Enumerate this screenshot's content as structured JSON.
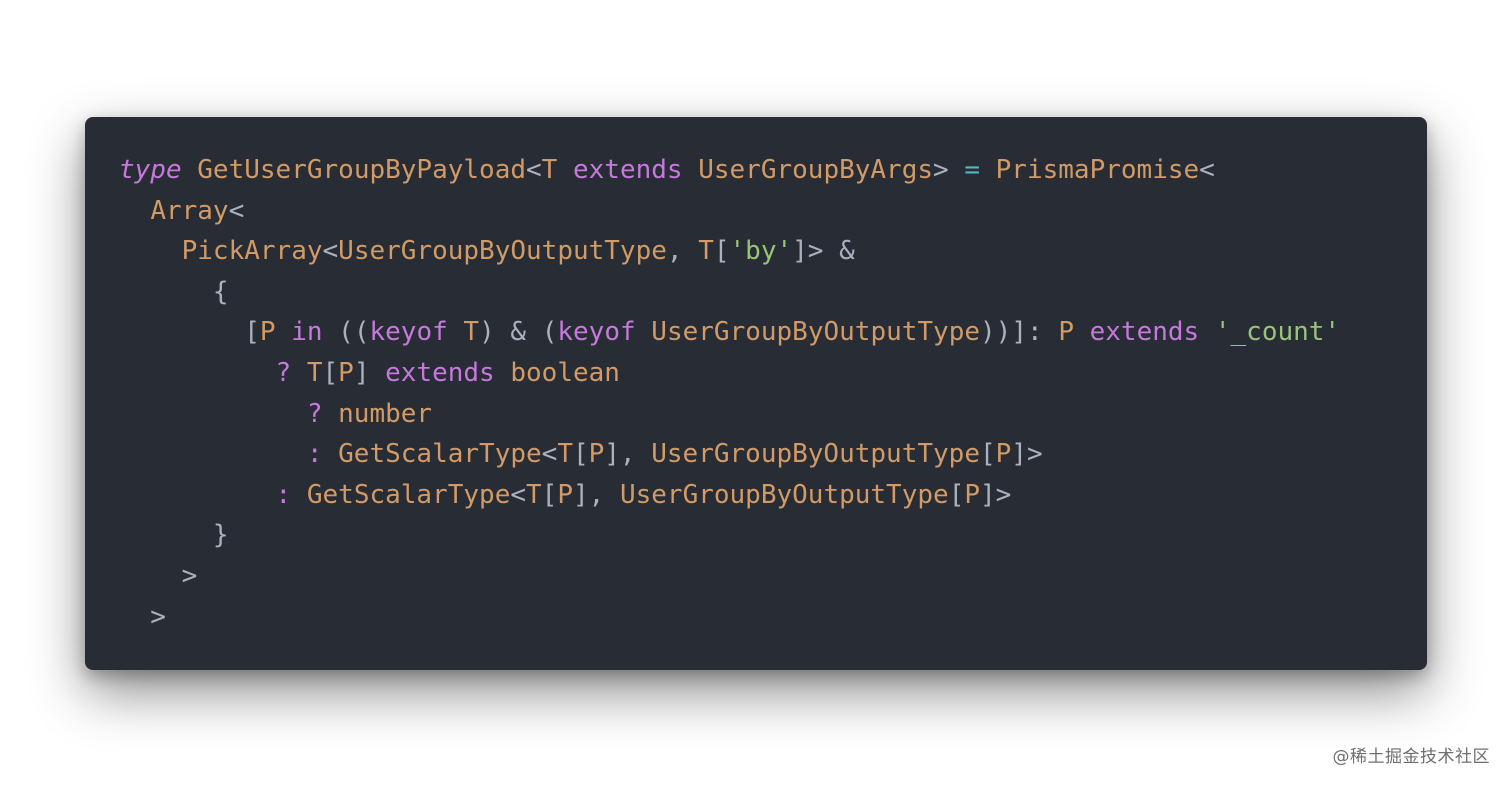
{
  "editor": {
    "theme_colors": {
      "background": "#282c34",
      "keyword": "#c678dd",
      "type": "#d19a66",
      "punctuation": "#abb2bf",
      "operator": "#56b6c2",
      "string": "#98c379"
    },
    "lines": [
      [
        {
          "t": "type",
          "k": "kwi"
        },
        {
          "t": " ",
          "k": "punc"
        },
        {
          "t": "GetUserGroupByPayload",
          "k": "type"
        },
        {
          "t": "<",
          "k": "punc"
        },
        {
          "t": "T",
          "k": "type"
        },
        {
          "t": " ",
          "k": "punc"
        },
        {
          "t": "extends",
          "k": "kw"
        },
        {
          "t": " ",
          "k": "punc"
        },
        {
          "t": "UserGroupByArgs",
          "k": "type"
        },
        {
          "t": "> ",
          "k": "punc"
        },
        {
          "t": "=",
          "k": "op"
        },
        {
          "t": " ",
          "k": "punc"
        },
        {
          "t": "PrismaPromise",
          "k": "type"
        },
        {
          "t": "<",
          "k": "punc"
        }
      ],
      [
        {
          "t": "  ",
          "k": "punc"
        },
        {
          "t": "Array",
          "k": "type"
        },
        {
          "t": "<",
          "k": "punc"
        }
      ],
      [
        {
          "t": "    ",
          "k": "punc"
        },
        {
          "t": "PickArray",
          "k": "type"
        },
        {
          "t": "<",
          "k": "punc"
        },
        {
          "t": "UserGroupByOutputType",
          "k": "type"
        },
        {
          "t": ", ",
          "k": "punc"
        },
        {
          "t": "T",
          "k": "type"
        },
        {
          "t": "[",
          "k": "punc"
        },
        {
          "t": "'by'",
          "k": "str"
        },
        {
          "t": "]> &",
          "k": "punc"
        }
      ],
      [
        {
          "t": "      {",
          "k": "punc"
        }
      ],
      [
        {
          "t": "        [",
          "k": "punc"
        },
        {
          "t": "P",
          "k": "type"
        },
        {
          "t": " ",
          "k": "punc"
        },
        {
          "t": "in",
          "k": "kw"
        },
        {
          "t": " ((",
          "k": "punc"
        },
        {
          "t": "keyof",
          "k": "kw"
        },
        {
          "t": " ",
          "k": "punc"
        },
        {
          "t": "T",
          "k": "type"
        },
        {
          "t": ") & (",
          "k": "punc"
        },
        {
          "t": "keyof",
          "k": "kw"
        },
        {
          "t": " ",
          "k": "punc"
        },
        {
          "t": "UserGroupByOutputType",
          "k": "type"
        },
        {
          "t": "))]: ",
          "k": "punc"
        },
        {
          "t": "P",
          "k": "type"
        },
        {
          "t": " ",
          "k": "punc"
        },
        {
          "t": "extends",
          "k": "kw"
        },
        {
          "t": " ",
          "k": "punc"
        },
        {
          "t": "'_count'",
          "k": "str"
        }
      ],
      [
        {
          "t": "          ",
          "k": "punc"
        },
        {
          "t": "?",
          "k": "kw"
        },
        {
          "t": " ",
          "k": "punc"
        },
        {
          "t": "T",
          "k": "type"
        },
        {
          "t": "[",
          "k": "punc"
        },
        {
          "t": "P",
          "k": "type"
        },
        {
          "t": "] ",
          "k": "punc"
        },
        {
          "t": "extends",
          "k": "kw"
        },
        {
          "t": " ",
          "k": "punc"
        },
        {
          "t": "boolean",
          "k": "type"
        }
      ],
      [
        {
          "t": "            ",
          "k": "punc"
        },
        {
          "t": "?",
          "k": "kw"
        },
        {
          "t": " ",
          "k": "punc"
        },
        {
          "t": "number",
          "k": "type"
        }
      ],
      [
        {
          "t": "            ",
          "k": "punc"
        },
        {
          "t": ":",
          "k": "kw"
        },
        {
          "t": " ",
          "k": "punc"
        },
        {
          "t": "GetScalarType",
          "k": "type"
        },
        {
          "t": "<",
          "k": "punc"
        },
        {
          "t": "T",
          "k": "type"
        },
        {
          "t": "[",
          "k": "punc"
        },
        {
          "t": "P",
          "k": "type"
        },
        {
          "t": "], ",
          "k": "punc"
        },
        {
          "t": "UserGroupByOutputType",
          "k": "type"
        },
        {
          "t": "[",
          "k": "punc"
        },
        {
          "t": "P",
          "k": "type"
        },
        {
          "t": "]>",
          "k": "punc"
        }
      ],
      [
        {
          "t": "          ",
          "k": "punc"
        },
        {
          "t": ":",
          "k": "kw"
        },
        {
          "t": " ",
          "k": "punc"
        },
        {
          "t": "GetScalarType",
          "k": "type"
        },
        {
          "t": "<",
          "k": "punc"
        },
        {
          "t": "T",
          "k": "type"
        },
        {
          "t": "[",
          "k": "punc"
        },
        {
          "t": "P",
          "k": "type"
        },
        {
          "t": "], ",
          "k": "punc"
        },
        {
          "t": "UserGroupByOutputType",
          "k": "type"
        },
        {
          "t": "[",
          "k": "punc"
        },
        {
          "t": "P",
          "k": "type"
        },
        {
          "t": "]>",
          "k": "punc"
        }
      ],
      [
        {
          "t": "      }",
          "k": "punc"
        }
      ],
      [
        {
          "t": "    >",
          "k": "punc"
        }
      ],
      [
        {
          "t": "  >",
          "k": "punc"
        }
      ]
    ]
  },
  "watermark": {
    "text": "@稀土掘金技术社区"
  }
}
